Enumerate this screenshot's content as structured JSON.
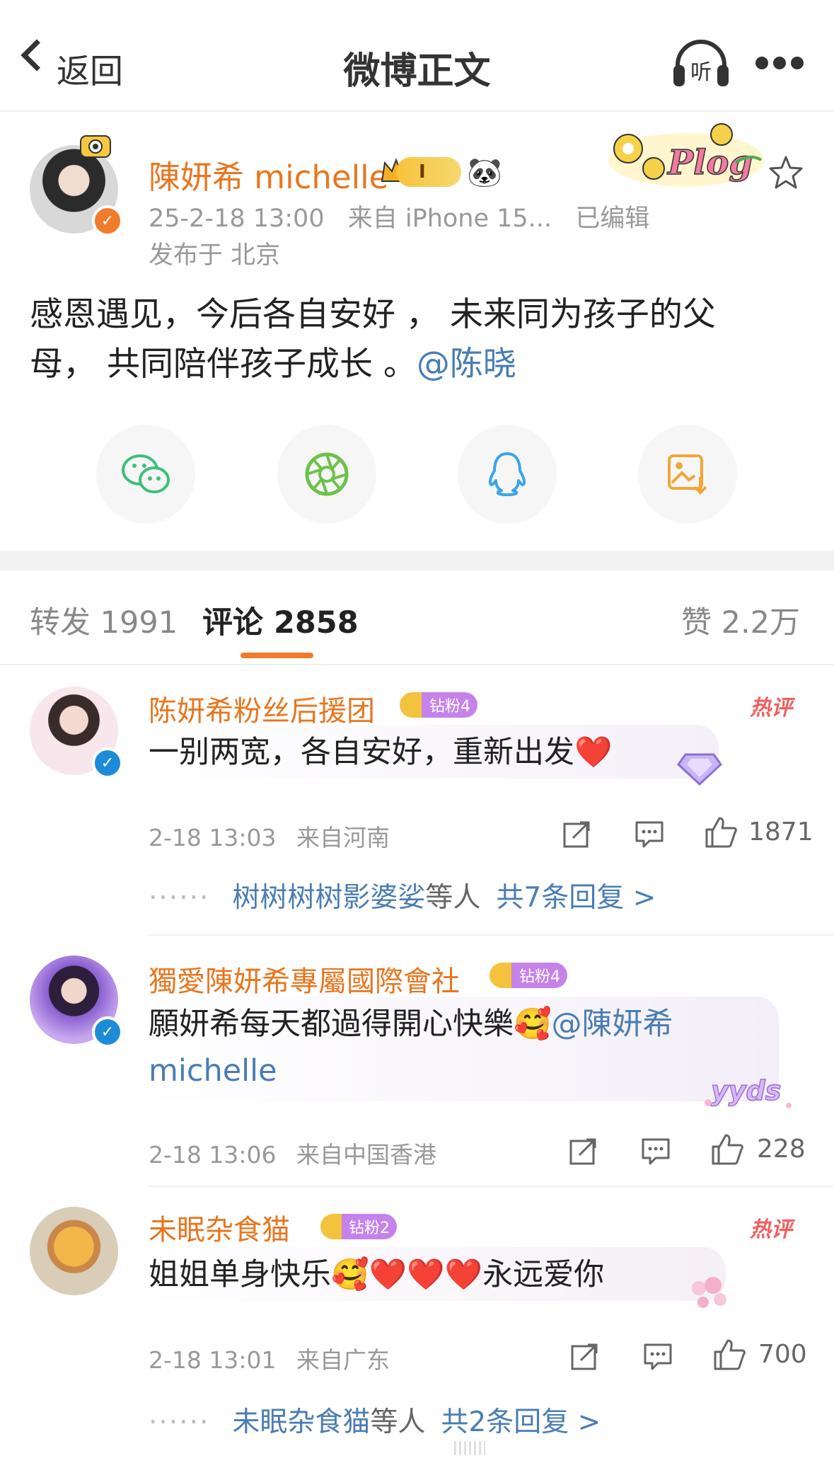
{
  "nav": {
    "back_label": "返回",
    "title": "微博正文",
    "listen_label": "听"
  },
  "post": {
    "author": "陳妍希 michelle",
    "crown_level": "I",
    "timestamp": "25-2-18 13:00",
    "source": "来自 iPhone 15...",
    "edited": "已编辑",
    "location": "发布于 北京",
    "text_line1": "感恩遇见，今后各自安好 ，  未来同为孩子的父",
    "text_line2": "母，  共同陪伴孩子成长 。",
    "mention": "@陈晓",
    "plog_label": "Plog"
  },
  "share": [
    "wechat-icon",
    "moments-icon",
    "qq-icon",
    "save-image-icon"
  ],
  "tabs": {
    "repost": "转发 1991",
    "comments": "评论 2858",
    "likes": "赞 2.2万"
  },
  "comments": [
    {
      "name": "陈妍希粉丝后援团",
      "badge": "钻粉4",
      "hot": "热评",
      "text": "一别两宽，各自安好，重新出发",
      "time": "2-18 13:03",
      "location": "来自河南",
      "likes": "1871",
      "replies_names": "树树树树影婆娑",
      "replies_suffix": "等人",
      "replies_link": "共7条回复 >"
    },
    {
      "name": "獨愛陳妍希專屬國際會社",
      "badge": "钻粉4",
      "text": "願妍希每天都過得開心快樂",
      "mention_line1": "@陳妍希",
      "mention_line2": "michelle",
      "sticker": "yyds",
      "time": "2-18 13:06",
      "location": "来自中国香港",
      "likes": "228"
    },
    {
      "name": "未眠杂食猫",
      "badge": "钻粉2",
      "hot": "热评",
      "text_a": "姐姐单身快乐",
      "text_b": "永远爱你",
      "time": "2-18 13:01",
      "location": "来自广东",
      "likes": "700",
      "replies_names": "未眠杂食猫",
      "replies_suffix": "等人",
      "replies_link": "共2条回复 >"
    }
  ],
  "colors": {
    "accent": "#e8761f",
    "link": "#4a7db3",
    "hot": "#f06060",
    "verified": "#1e8bd8"
  }
}
